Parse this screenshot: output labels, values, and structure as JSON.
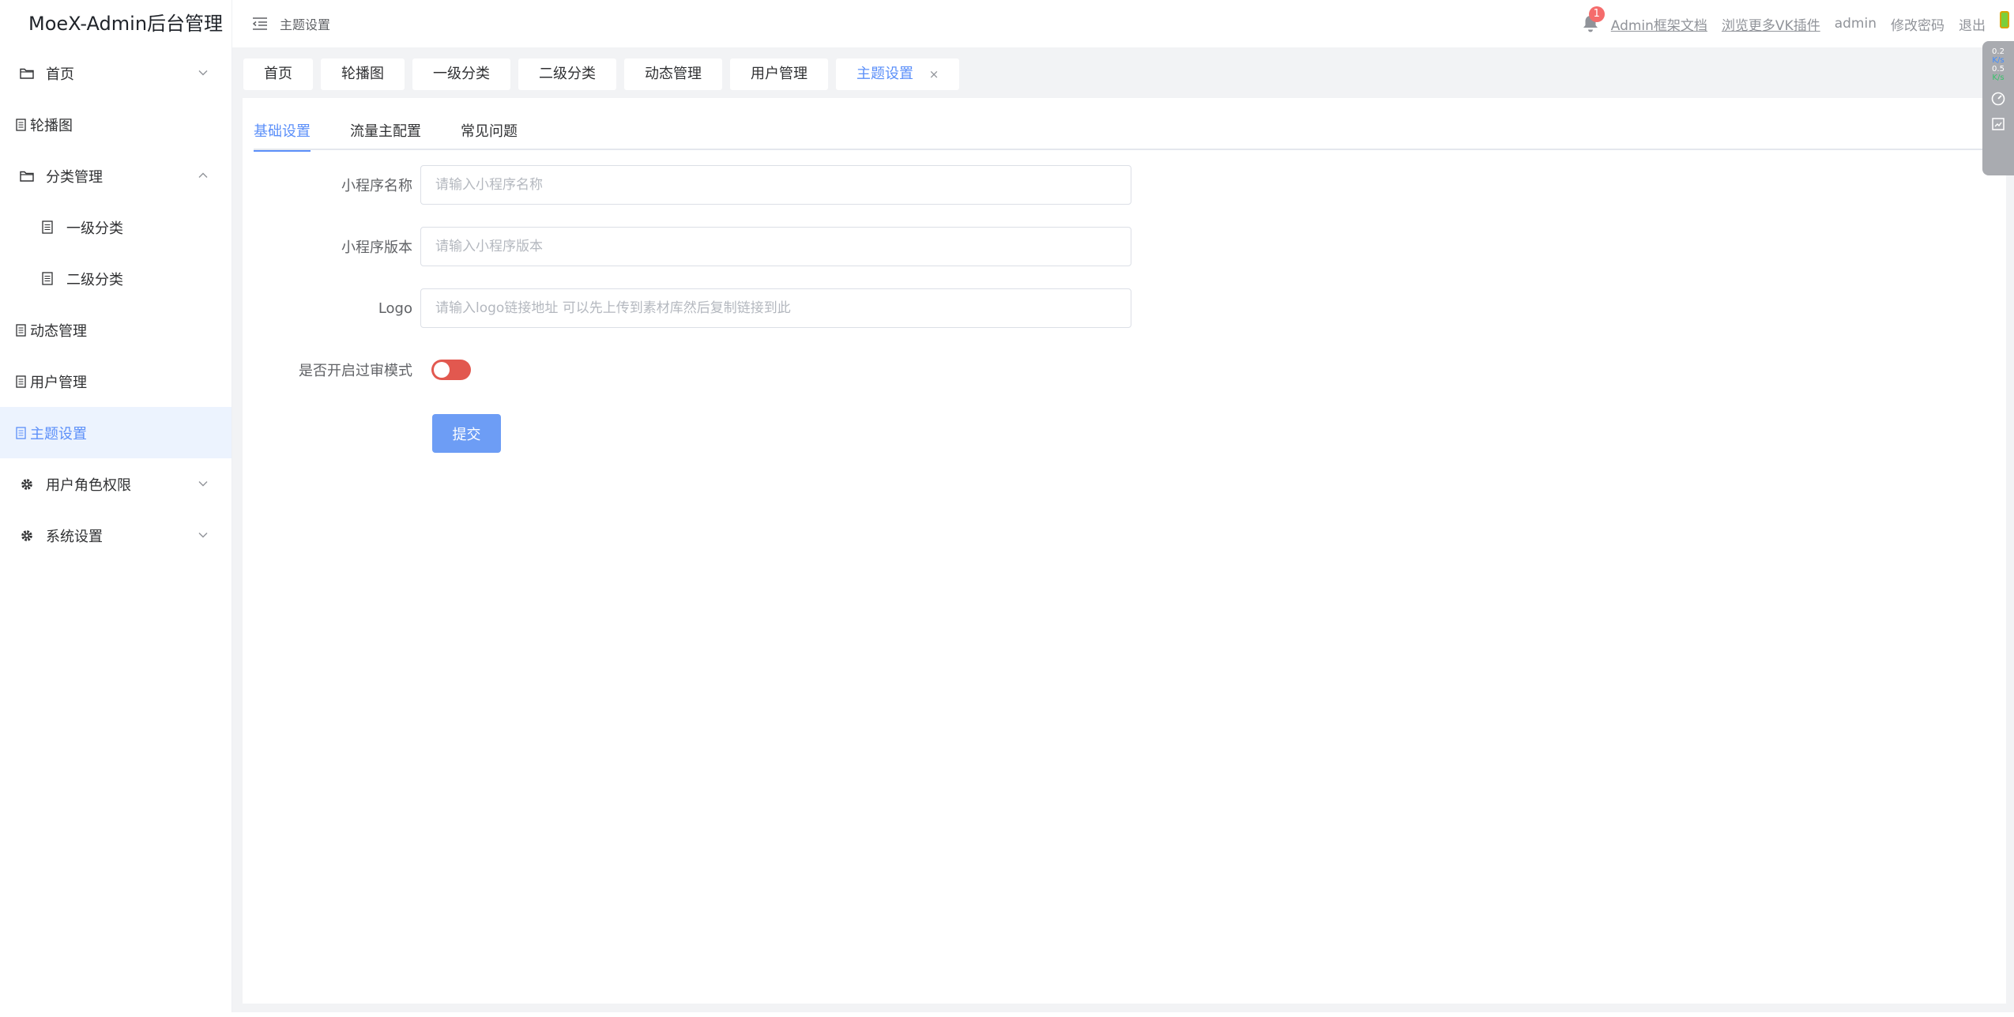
{
  "app": {
    "title": "MoeX-Admin后台管理"
  },
  "sidebar": {
    "items": [
      {
        "label": "首页",
        "icon": "folder-icon",
        "level": 0,
        "arrow": "down"
      },
      {
        "label": "轮播图",
        "icon": "document-icon",
        "level": 0
      },
      {
        "label": "分类管理",
        "icon": "folder-icon",
        "level": 0,
        "arrow": "up"
      },
      {
        "label": "一级分类",
        "icon": "document-icon",
        "level": 1
      },
      {
        "label": "二级分类",
        "icon": "document-icon",
        "level": 1
      },
      {
        "label": "动态管理",
        "icon": "document-icon",
        "level": 0
      },
      {
        "label": "用户管理",
        "icon": "document-icon",
        "level": 0
      },
      {
        "label": "主题设置",
        "icon": "document-icon",
        "level": 0,
        "active": true
      },
      {
        "label": "用户角色权限",
        "icon": "gear-icon",
        "level": 0,
        "arrow": "down"
      },
      {
        "label": "系统设置",
        "icon": "gear-icon",
        "level": 0,
        "arrow": "down"
      }
    ]
  },
  "header": {
    "breadcrumb": "主题设置",
    "notification_count": "1",
    "docs_link": "Admin框架文档",
    "plugins_link": "浏览更多VK插件",
    "username": "admin",
    "change_password": "修改密码",
    "logout": "退出"
  },
  "tabs": [
    {
      "label": "首页"
    },
    {
      "label": "轮播图"
    },
    {
      "label": "一级分类"
    },
    {
      "label": "二级分类"
    },
    {
      "label": "动态管理"
    },
    {
      "label": "用户管理"
    },
    {
      "label": "主题设置",
      "active": true,
      "closable": true,
      "close_glyph": "×"
    }
  ],
  "subtabs": [
    {
      "label": "基础设置",
      "active": true
    },
    {
      "label": "流量主配置"
    },
    {
      "label": "常见问题"
    }
  ],
  "form": {
    "app_name": {
      "label": "小程序名称",
      "placeholder": "请输入小程序名称",
      "value": ""
    },
    "app_version": {
      "label": "小程序版本",
      "placeholder": "请输入小程序版本",
      "value": ""
    },
    "logo": {
      "label": "Logo",
      "placeholder": "请输入logo链接地址 可以先上传到素材库然后复制链接到此",
      "value": ""
    },
    "review_mode": {
      "label": "是否开启过审模式",
      "enabled": false
    },
    "submit_label": "提交"
  },
  "float_tools": {
    "upload_speed": "0.2",
    "upload_unit": "K/s",
    "download_speed": "0.5",
    "download_unit": "K/s"
  },
  "colors": {
    "accent": "#5b8ff9",
    "active_menu_bg": "#ecf3fe",
    "switch_off": "#e2584f",
    "submit_bg": "#6d9df5",
    "badge": "#f56c6c",
    "content_bg": "#f2f3f5"
  }
}
